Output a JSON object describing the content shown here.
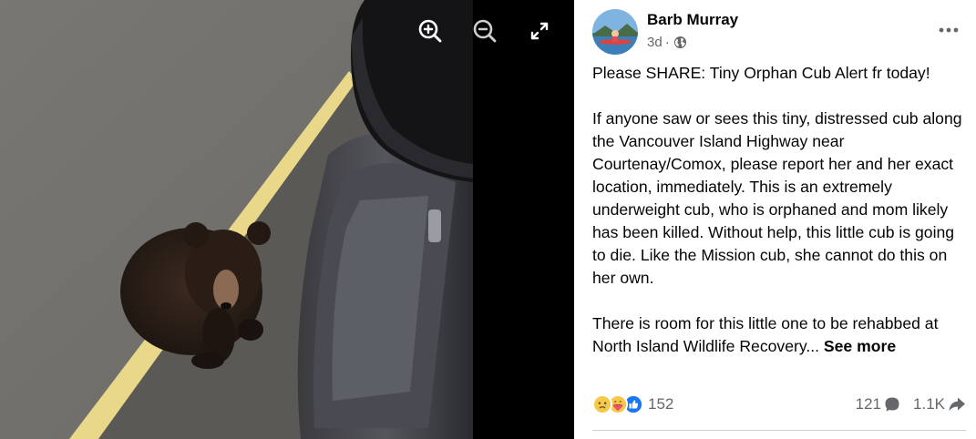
{
  "viewer": {
    "tools": [
      {
        "name": "zoom-in-icon"
      },
      {
        "name": "zoom-out-icon"
      },
      {
        "name": "fullscreen-icon"
      }
    ]
  },
  "post": {
    "author": "Barb Murray",
    "time": "3d",
    "separator": "·",
    "privacy_icon": "globe-icon",
    "more_icon": "more-options-icon",
    "paragraphs": [
      "Please SHARE: Tiny Orphan Cub Alert fr today!",
      "If anyone saw or sees this tiny, distressed cub along the Vancouver Island Highway near Courtenay/Comox, please report her and her exact location, immediately. This is an extremely underweight cub, who is orphaned and mom likely has been killed. Without help, this little cub is going to die. Like the Mission cub, she cannot do this on her own.",
      "There is room for this little one to be rehabbed at North Island Wildlife Recovery..."
    ],
    "see_more": "See more"
  },
  "engagement": {
    "reaction_icons": [
      "sad-icon",
      "care-icon",
      "like-icon"
    ],
    "reaction_count": "152",
    "comment_count": "121",
    "share_count": "1.1K"
  },
  "colors": {
    "text": "#050505",
    "secondary": "#65676b",
    "like_blue": "#1877f2",
    "divider": "#ced0d4"
  }
}
